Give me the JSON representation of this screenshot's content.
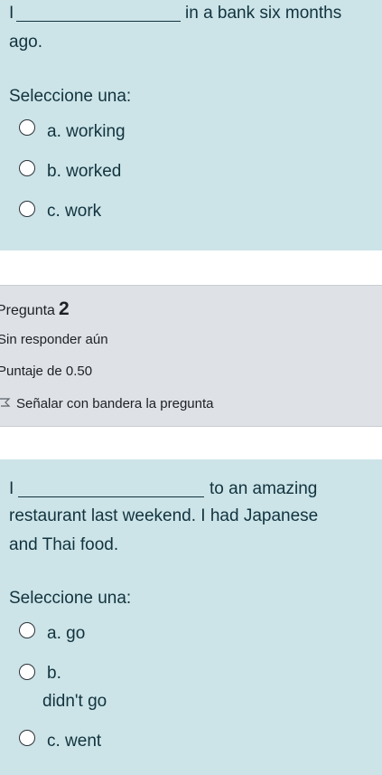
{
  "question1": {
    "subject": "I",
    "sentence_end": "in a bank six months",
    "sentence_cont": "ago.",
    "prompt": "Seleccione una:",
    "options": [
      {
        "label": "a. working"
      },
      {
        "label": "b. worked"
      },
      {
        "label": "c. work"
      }
    ]
  },
  "question2_info": {
    "title_prefix": "Pregunta",
    "number": "2",
    "status": "Sin responder aún",
    "score": "Puntaje de 0.50",
    "flag_label": "Señalar con bandera la pregunta"
  },
  "question2": {
    "subject": "I",
    "line1_end": "to an amazing",
    "line2": "restaurant last weekend. I had Japanese",
    "line3": "and Thai food.",
    "prompt": "Seleccione una:",
    "options": [
      {
        "label": "a. go"
      },
      {
        "label": "b.",
        "label_cont": "didn't go"
      },
      {
        "label": "c. went"
      }
    ]
  }
}
